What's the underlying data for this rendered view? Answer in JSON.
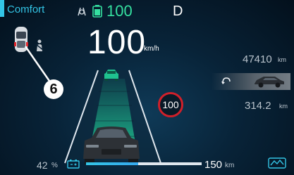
{
  "top_bar": {
    "drive_mode": "Comfort",
    "battery_percent": "100",
    "gear": "D"
  },
  "speed": {
    "value": "100",
    "unit": "km/h"
  },
  "speed_limit_sign": "100",
  "callout_number": "6",
  "odometer": {
    "value": "47410",
    "unit": "km"
  },
  "trip": {
    "value": "314.2",
    "unit": "km"
  },
  "bottom_bar": {
    "charge_percent": "42",
    "charge_percent_unit": "%",
    "range_value": "150",
    "range_unit": "km",
    "charge_level": 0.45
  },
  "colors": {
    "accent": "#33c5e6",
    "battery_green": "#35e0a0",
    "speed_limit_red": "#d0202a"
  },
  "icons": [
    "driver-assist-icon",
    "battery-icon",
    "car-top-view-icon",
    "seatbelt-icon",
    "return-icon",
    "car-side-icon",
    "battery-outline-icon",
    "eco-icon"
  ]
}
